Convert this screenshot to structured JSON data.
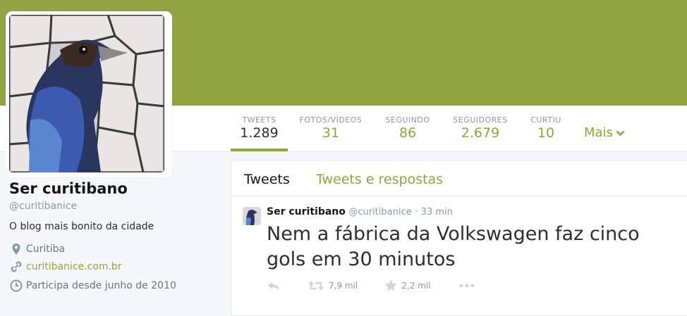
{
  "profile": {
    "name": "Ser curitibano",
    "handle": "@curitibanice",
    "bio": "O blog mais bonito da cidade",
    "location": "Curitiba",
    "website": "curitibanice.com.br",
    "joined": "Participa desde junho de 2010"
  },
  "stats": [
    {
      "label": "TWEETS",
      "value": "1.289"
    },
    {
      "label": "FOTOS/VÍDEOS",
      "value": "31"
    },
    {
      "label": "SEGUINDO",
      "value": "86"
    },
    {
      "label": "SEGUIDORES",
      "value": "2.679"
    },
    {
      "label": "CURTIU",
      "value": "10"
    }
  ],
  "more_label": "Mais",
  "timeline_tabs": [
    "Tweets",
    "Tweets e respostas"
  ],
  "tweet": {
    "name": "Ser curitibano",
    "handle": "@curitibanice",
    "separator": "·",
    "time": "33 min",
    "text": "Nem a fábrica da Volkswagen faz cinco gols em 30 minutos",
    "retweets": "7,9 mil",
    "likes": "2,2 mil"
  },
  "colors": {
    "accent": "#91a442",
    "muted": "#8899a6",
    "text": "#292f33"
  },
  "icons": [
    "map-pin-icon",
    "link-icon",
    "clock-icon",
    "reply-icon",
    "retweet-icon",
    "star-icon",
    "more-icon",
    "chevron-down-icon"
  ]
}
